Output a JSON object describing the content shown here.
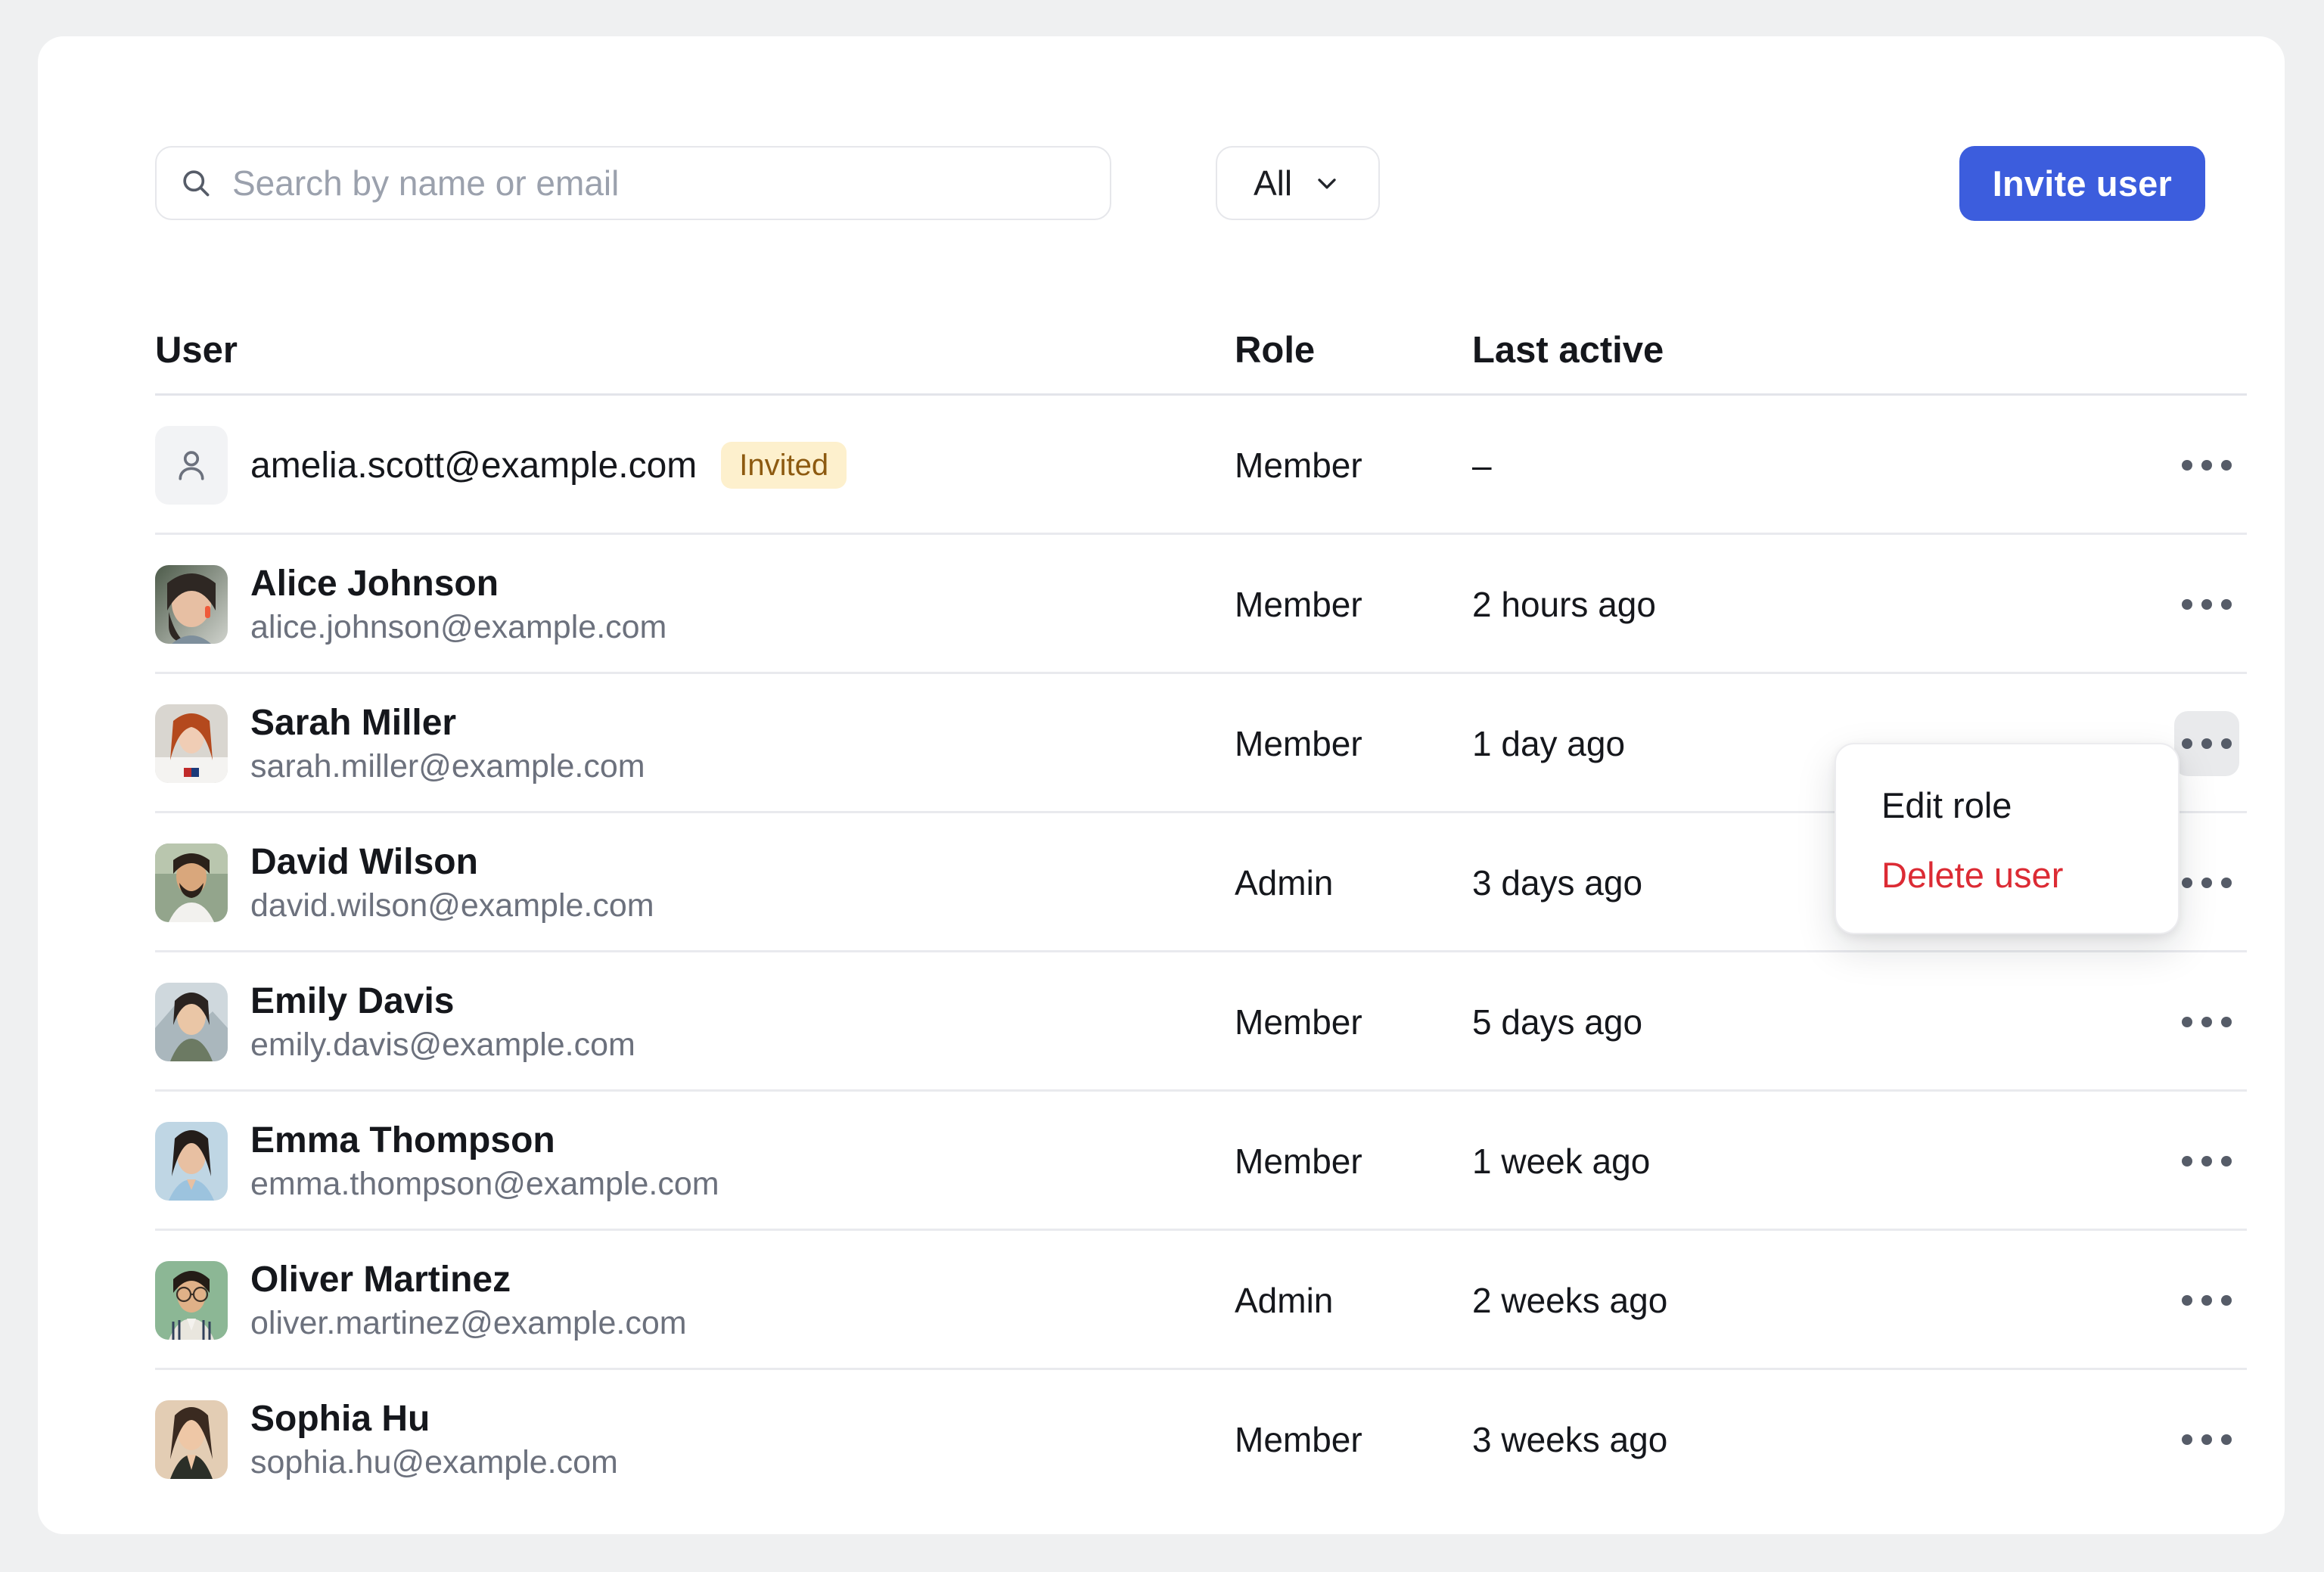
{
  "toolbar": {
    "search_placeholder": "Search by name or email",
    "search_value": "",
    "search_icon": "search-icon",
    "filter_label": "All",
    "filter_icon": "chevron-down-icon",
    "invite_label": "Invite user",
    "accent_color": "#3c5ddd"
  },
  "table": {
    "columns": [
      "User",
      "Role",
      "Last active"
    ],
    "rows": [
      {
        "name": "",
        "email": "amelia.scott@example.com",
        "display": "amelia.scott@example.com",
        "badge": "Invited",
        "badge_bg": "#fdf0cd",
        "badge_color": "#8d5a10",
        "role": "Member",
        "last_active": "–",
        "avatar": "placeholder-person-icon"
      },
      {
        "name": "Alice Johnson",
        "email": "alice.johnson@example.com",
        "role": "Member",
        "last_active": "2 hours ago",
        "avatar": "photo"
      },
      {
        "name": "Sarah Miller",
        "email": "sarah.miller@example.com",
        "role": "Member",
        "last_active": "1 day ago",
        "avatar": "photo"
      },
      {
        "name": "David Wilson",
        "email": "david.wilson@example.com",
        "role": "Admin",
        "last_active": "3 days ago",
        "avatar": "photo"
      },
      {
        "name": "Emily Davis",
        "email": "emily.davis@example.com",
        "role": "Member",
        "last_active": "5 days ago",
        "avatar": "photo"
      },
      {
        "name": "Emma Thompson",
        "email": "emma.thompson@example.com",
        "role": "Member",
        "last_active": "1 week ago",
        "avatar": "photo"
      },
      {
        "name": "Oliver Martinez",
        "email": "oliver.martinez@example.com",
        "role": "Admin",
        "last_active": "2 weeks ago",
        "avatar": "photo"
      },
      {
        "name": "Sophia Hu",
        "email": "sophia.hu@example.com",
        "role": "Member",
        "last_active": "3 weeks ago",
        "avatar": "photo"
      }
    ]
  },
  "context_menu": {
    "open_for_row": 2,
    "items": [
      {
        "label": "Edit role",
        "danger": false
      },
      {
        "label": "Delete user",
        "danger": true
      }
    ],
    "danger_color": "#dc2b34"
  }
}
